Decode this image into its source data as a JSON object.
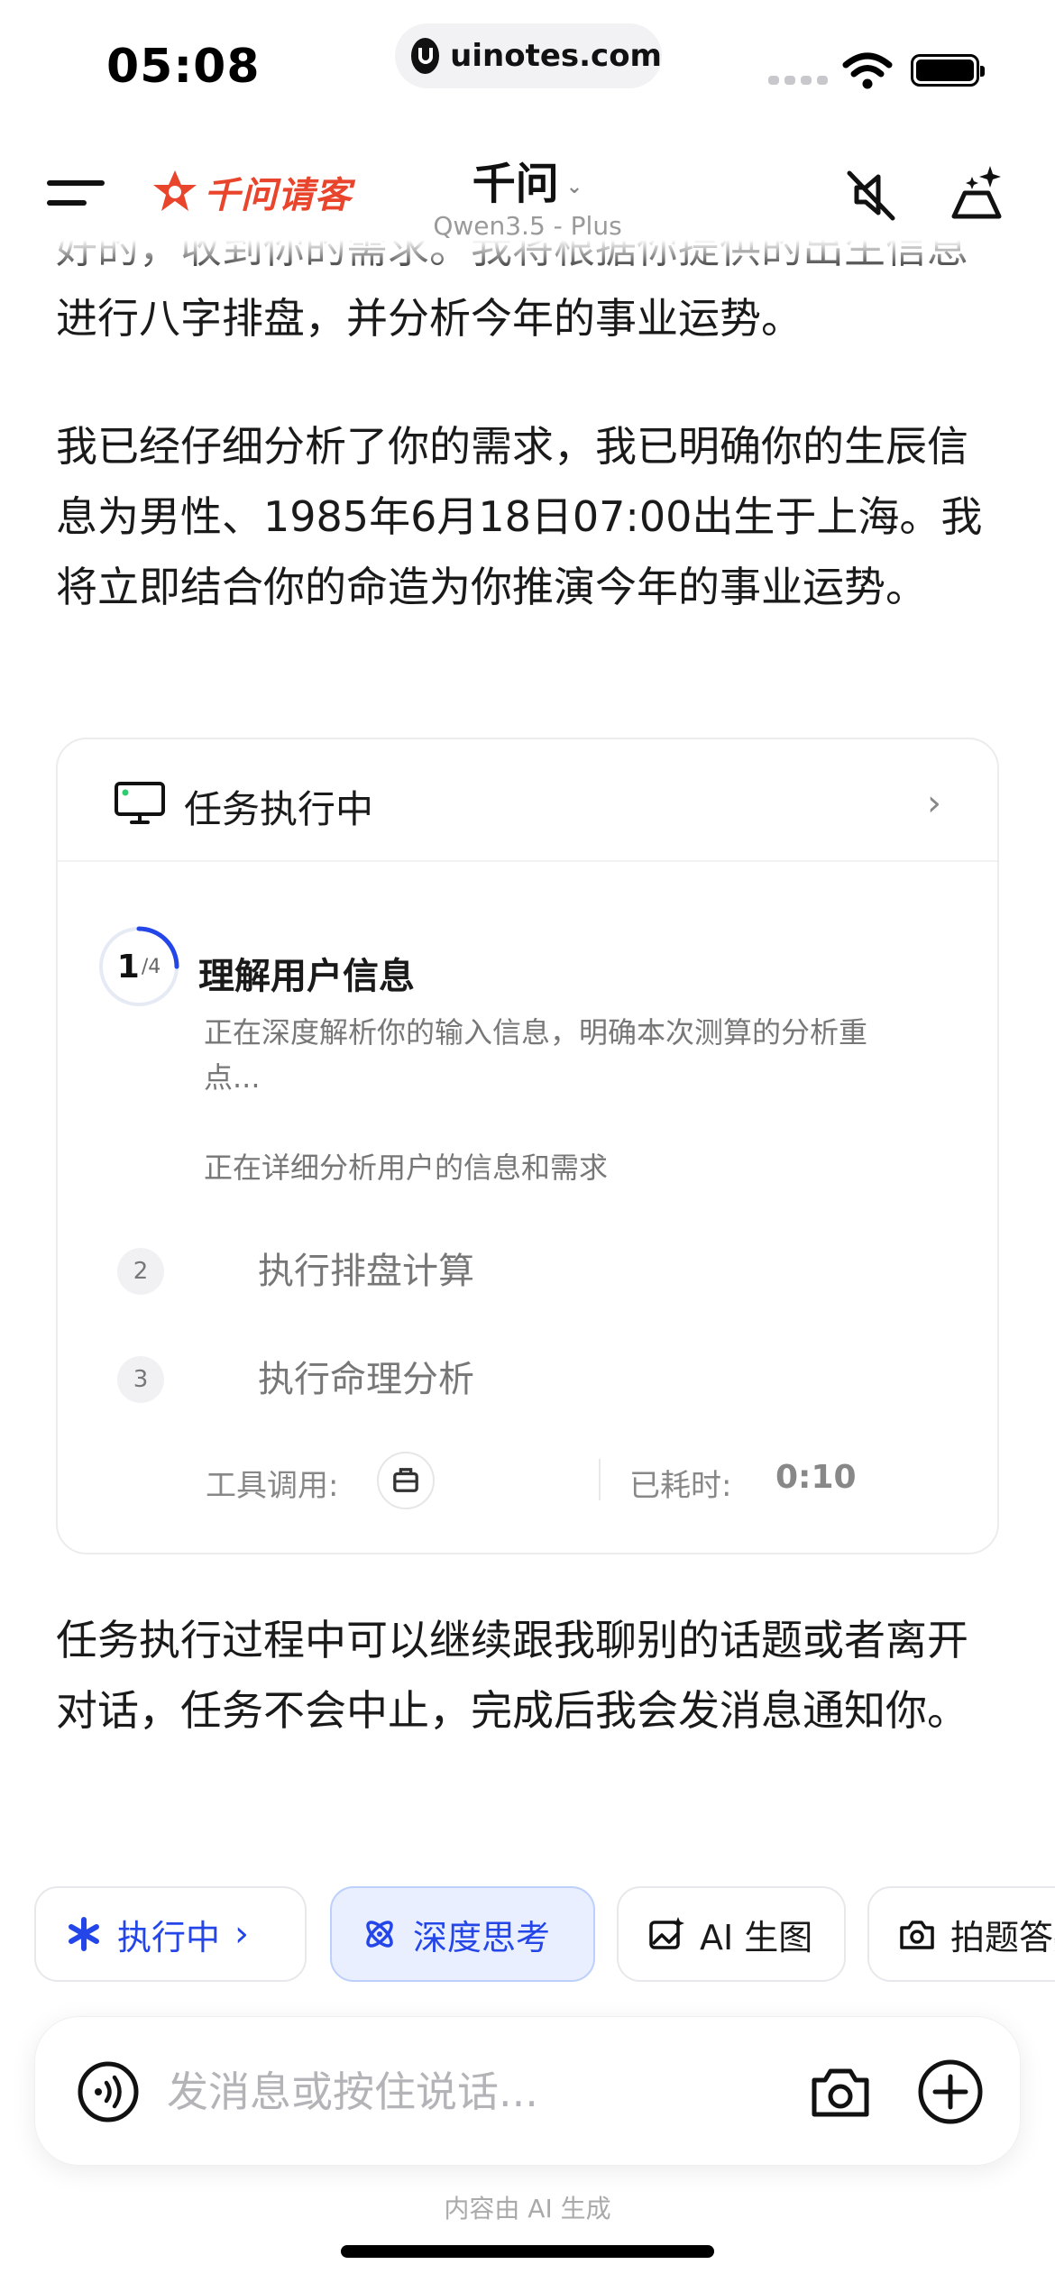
{
  "status": {
    "time": "05:08",
    "url": "uinotes.com"
  },
  "nav": {
    "brand": "千问请客",
    "title": "千问",
    "model": "Qwen3.5 - Plus"
  },
  "messages": {
    "intro_cut": "好的，收到你的需求。我将根据你提供的出生信息进行八字排盘，并分析今年的事业运势。",
    "analysis": "我已经仔细分析了你的需求，我已明确你的生辰信息为男性、1985年6月18日07:00出生于上海。我将立即结合你的命造为你推演今年的事业运势。",
    "followup": "任务执行过程中可以继续跟我聊别的话题或者离开对话，任务不会中止，完成后我会发消息通知你。"
  },
  "task_card": {
    "title": "任务执行中",
    "progress": {
      "current": "1",
      "total": "/4",
      "fraction": 0.25
    },
    "active_step": {
      "title": "理解用户信息",
      "description": "正在深度解析你的输入信息，明确本次测算的分析重点...",
      "note": "正在详细分析用户的信息和需求"
    },
    "pending_steps": [
      {
        "num": "2",
        "label": "执行排盘计算"
      },
      {
        "num": "3",
        "label": "执行命理分析"
      }
    ],
    "footer": {
      "tools_label": "工具调用:",
      "elapsed_label": "已耗时:",
      "elapsed_value": "0:10"
    }
  },
  "chips": [
    {
      "label": "执行中",
      "icon": "asterisk-icon"
    },
    {
      "label": "深度思考",
      "icon": "atom-icon"
    },
    {
      "label": "AI 生图",
      "icon": "image-spark-icon"
    },
    {
      "label": "拍题答疑",
      "icon": "camera-question-icon"
    }
  ],
  "input": {
    "placeholder": "发消息或按住说话..."
  },
  "disclaimer": "内容由 AI 生成",
  "colors": {
    "accent": "#2446e8",
    "brand": "#e8452c",
    "chip_active_bg": "#e9effe"
  }
}
